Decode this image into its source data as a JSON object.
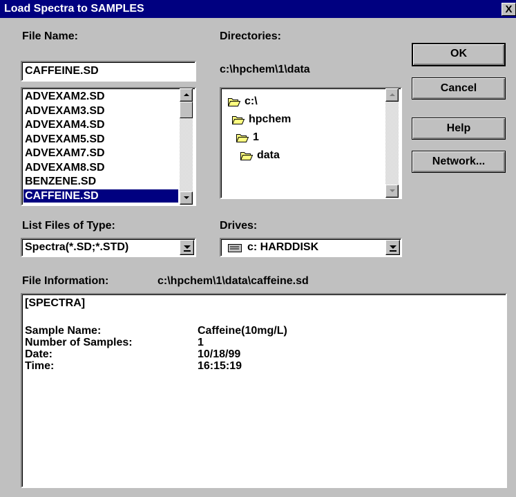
{
  "window": {
    "title": "Load Spectra to SAMPLES",
    "close_label": "X"
  },
  "file_name": {
    "label": "File Name:",
    "value": "CAFFEINE.SD"
  },
  "file_list": {
    "items": [
      "ADVEXAM2.SD",
      "ADVEXAM3.SD",
      "ADVEXAM4.SD",
      "ADVEXAM5.SD",
      "ADVEXAM7.SD",
      "ADVEXAM8.SD",
      "BENZENE.SD",
      "CAFFEINE.SD"
    ],
    "selected": "CAFFEINE.SD"
  },
  "directories": {
    "label": "Directories:",
    "current_path": "c:\\hpchem\\1\\data",
    "tree": [
      {
        "name": "c:\\",
        "icon": "open-folder-icon"
      },
      {
        "name": "hpchem",
        "icon": "open-folder-icon"
      },
      {
        "name": "1",
        "icon": "open-folder-icon"
      },
      {
        "name": "data",
        "icon": "open-folder-icon"
      }
    ]
  },
  "buttons": {
    "ok": "OK",
    "cancel": "Cancel",
    "help": "Help",
    "network": "Network..."
  },
  "file_type": {
    "label": "List Files of Type:",
    "value": "Spectra(*.SD;*.STD)"
  },
  "drives": {
    "label": "Drives:",
    "value": "c: HARDDISK",
    "icon": "hard-drive-icon"
  },
  "file_information": {
    "label": "File Information:",
    "path": "c:\\hpchem\\1\\data\\caffeine.sd",
    "header": "[SPECTRA]",
    "rows": [
      {
        "key": "Sample Name:",
        "value": "Caffeine(10mg/L)"
      },
      {
        "key": "Number of Samples:",
        "value": "1"
      },
      {
        "key": "Date:",
        "value": "10/18/99"
      },
      {
        "key": "Time:",
        "value": "16:15:19"
      }
    ]
  },
  "colors": {
    "titlebar": "#000080",
    "face": "#c0c0c0",
    "selection": "#000080"
  }
}
